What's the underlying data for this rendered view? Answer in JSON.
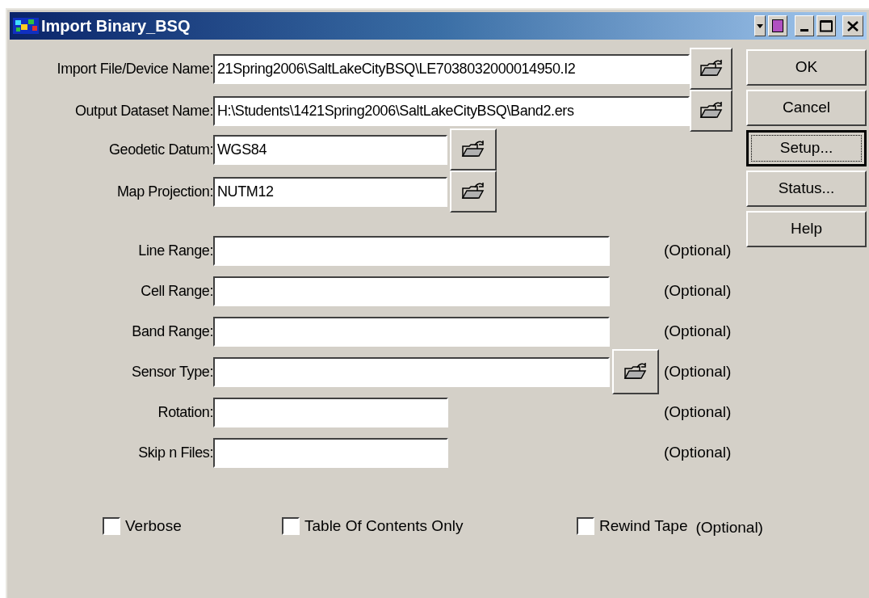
{
  "window": {
    "title": "Import Binary_BSQ"
  },
  "file_fields": [
    {
      "label": "Import File/Device Name:",
      "value": "21Spring2006\\SaltLakeCityBSQ\\LE7038032000014950.I2"
    },
    {
      "label": "Output Dataset Name:",
      "value": "H:\\Students\\1421Spring2006\\SaltLakeCityBSQ\\Band2.ers"
    }
  ],
  "setting_fields": [
    {
      "label": "Geodetic Datum:",
      "value": "WGS84"
    },
    {
      "label": "Map Projection:",
      "value": "NUTM12"
    }
  ],
  "optional_fields": [
    {
      "label": "Line Range:",
      "kind": "long",
      "browse": false,
      "note": "(Optional)"
    },
    {
      "label": "Cell Range:",
      "kind": "long",
      "browse": false,
      "note": "(Optional)"
    },
    {
      "label": "Band Range:",
      "kind": "long",
      "browse": false,
      "note": "(Optional)"
    },
    {
      "label": "Sensor Type:",
      "kind": "long",
      "browse": true,
      "note": "(Optional)"
    },
    {
      "label": "Rotation:",
      "kind": "short",
      "browse": false,
      "note": "(Optional)"
    },
    {
      "label": "Skip n Files:",
      "kind": "short",
      "browse": false,
      "note": "(Optional)"
    }
  ],
  "buttons": [
    {
      "label": "OK",
      "default": false
    },
    {
      "label": "Cancel",
      "default": false
    },
    {
      "label": "Setup...",
      "default": true
    },
    {
      "label": "Status...",
      "default": false
    },
    {
      "label": "Help",
      "default": false
    }
  ],
  "checkboxes": [
    {
      "label": "Verbose",
      "checked": false
    },
    {
      "label": "Table Of Contents Only",
      "checked": false
    },
    {
      "label": "Rewind Tape",
      "checked": false,
      "note": "(Optional)"
    }
  ]
}
